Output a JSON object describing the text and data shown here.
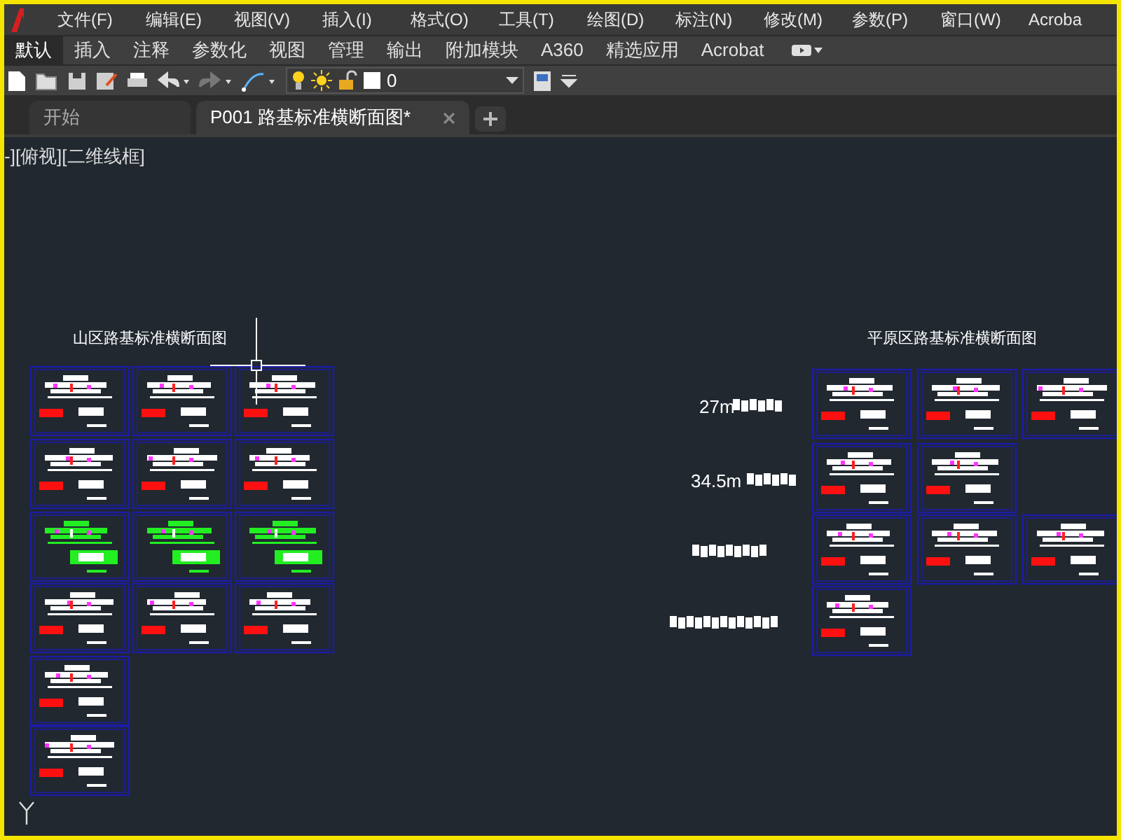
{
  "menu_bar": {
    "items": [
      "文件(F)",
      "编辑(E)",
      "视图(V)",
      "插入(I)",
      "格式(O)",
      "工具(T)",
      "绘图(D)",
      "标注(N)",
      "修改(M)",
      "参数(P)",
      "窗口(W)",
      "Acroba"
    ]
  },
  "ribbon_tabs": [
    {
      "label": "默认",
      "selected": true
    },
    {
      "label": "插入",
      "selected": false
    },
    {
      "label": "注释",
      "selected": false
    },
    {
      "label": "参数化",
      "selected": false
    },
    {
      "label": "视图",
      "selected": false
    },
    {
      "label": "管理",
      "selected": false
    },
    {
      "label": "输出",
      "selected": false
    },
    {
      "label": "附加模块",
      "selected": false
    },
    {
      "label": "A360",
      "selected": false
    },
    {
      "label": "精选应用",
      "selected": false
    },
    {
      "label": "Acrobat",
      "selected": false
    }
  ],
  "toolbar": {
    "layer": {
      "name": "0"
    }
  },
  "doc_tabs": [
    {
      "label": "开始",
      "selected": false,
      "closable": false
    },
    {
      "label": "P001  路基标准横断面图*",
      "selected": true,
      "closable": true
    }
  ],
  "viewport": {
    "label": "-][俯视][二维线框]"
  },
  "left_group": {
    "title": "山区路基标准横断面图",
    "rows": [
      [
        {
          "kind": "white"
        },
        {
          "kind": "white"
        },
        {
          "kind": "white"
        }
      ],
      [
        {
          "kind": "white"
        },
        {
          "kind": "white"
        },
        {
          "kind": "white"
        }
      ],
      [
        {
          "kind": "green"
        },
        {
          "kind": "green"
        },
        {
          "kind": "green"
        }
      ],
      [
        {
          "kind": "white"
        },
        {
          "kind": "white"
        },
        {
          "kind": "white"
        }
      ],
      [
        {
          "kind": "white"
        }
      ],
      [
        {
          "kind": "white"
        }
      ]
    ]
  },
  "right_group": {
    "title": "平原区路基标准横断面图",
    "rows": [
      {
        "label": "27m",
        "sheets": [
          {
            "kind": "white"
          },
          {
            "kind": "white"
          },
          {
            "kind": "white"
          }
        ]
      },
      {
        "label": "34.5m",
        "sheets": [
          {
            "kind": "white"
          },
          {
            "kind": "white"
          }
        ]
      },
      {
        "sheets": [
          {
            "kind": "white"
          },
          {
            "kind": "white"
          },
          {
            "kind": "white"
          }
        ]
      },
      {
        "sheets": [
          {
            "kind": "white"
          }
        ]
      }
    ]
  }
}
